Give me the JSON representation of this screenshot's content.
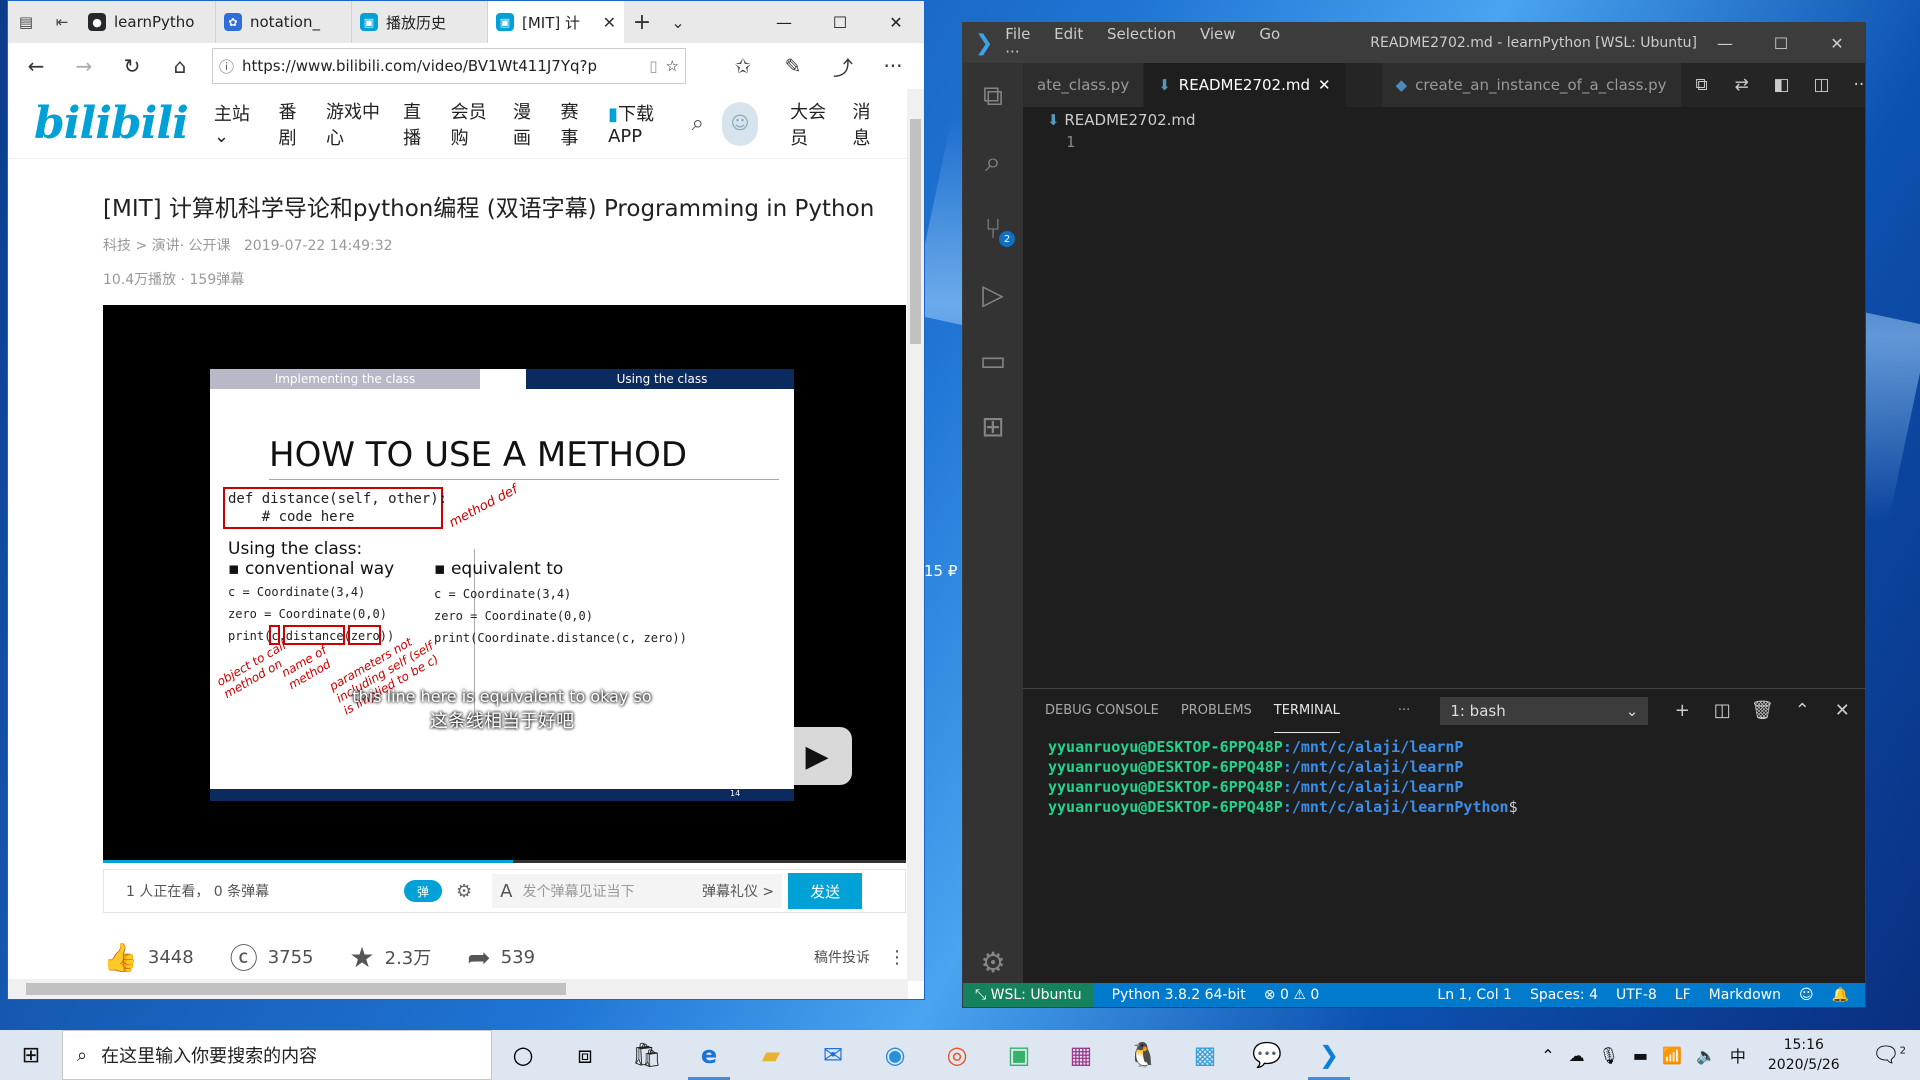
{
  "desktop": {
    "peek_text": "15 ₽"
  },
  "edge": {
    "tabs": [
      {
        "label": "learnPytho",
        "favicon": "github-icon",
        "color": "#24292e"
      },
      {
        "label": "notation_",
        "favicon": "baidu-icon",
        "color": "#2f6dd8"
      },
      {
        "label": "播放历史",
        "favicon": "bilibili-icon",
        "color": "#00a1d6"
      },
      {
        "label": "[MIT] 计",
        "favicon": "bilibili-icon",
        "color": "#00a1d6"
      }
    ],
    "url": "https://www.bilibili.com/video/BV1Wt411J7Yq?p",
    "nav": {
      "main": "主站",
      "items": [
        "番剧",
        "游戏中心",
        "直播",
        "会员购",
        "漫画",
        "赛事"
      ],
      "download": "下载APP",
      "vip": "大会员",
      "msg": "消息"
    },
    "video": {
      "title": "[MIT] 计算机科学导论和python编程 (双语字幕) Programming in Python",
      "category": "科技 > 演讲· 公开课",
      "date": "2019-07-22 14:49:32",
      "stats": "10.4万播放 · 159弹幕",
      "slide": {
        "tab_left": "Implementing the class",
        "tab_right": "Using the class",
        "heading": "HOW TO USE A METHOD",
        "code1": "def distance(self, other):",
        "code2": "    # code here",
        "method_def": "method def",
        "using": "Using the class:",
        "conventional": "conventional way",
        "equivalent": "equivalent to",
        "l1": "c = Coordinate(3,4)",
        "l2": "zero = Coordinate(0,0)",
        "l3": "print(c.distance(zero))",
        "r1": "c = Coordinate(3,4)",
        "r2": "zero = Coordinate(0,0)",
        "r3": "print(Coordinate.distance(c, zero))",
        "ann1": "object to call method on",
        "ann2": "name of method",
        "ann3": "parameters not including self (self is implied to be c)",
        "page": "14"
      },
      "subtitle_en": "this line here is equivalent to okay so",
      "subtitle_zh": "这条线相当于好吧",
      "progress": 0.51
    },
    "danmaku": {
      "watching": "1 人正在看， 0 条弹幕",
      "toggle": "弹",
      "placeholder": "发个弹幕见证当下",
      "etiquette": "弹幕礼仪 >",
      "send": "发送"
    },
    "actions": {
      "like": "3448",
      "coin": "3755",
      "fav": "2.3万",
      "share": "539",
      "report": "稿件投诉"
    }
  },
  "vscode": {
    "menu": [
      "File",
      "Edit",
      "Selection",
      "View",
      "Go",
      "···"
    ],
    "title": "README2702.md - learnPython [WSL: Ubuntu] ...",
    "tabs": [
      {
        "label": "ate_class.py",
        "icon": "python-icon"
      },
      {
        "label": "README2702.md",
        "icon": "markdown-icon"
      },
      {
        "label": "create_an_instance_of_a_class.py",
        "icon": "python-icon"
      }
    ],
    "breadcrumb": "README2702.md",
    "line": "1",
    "scm_badge": "2",
    "panel_tabs": [
      "DEBUG CONSOLE",
      "PROBLEMS",
      "TERMINAL",
      "···"
    ],
    "terminal_select": "1: bash",
    "terminal_lines": [
      {
        "user": "yyuanruoyu@DESKTOP-6PPQ48P",
        "path": ":/mnt/c/alaji/learnP"
      },
      {
        "user": "yyuanruoyu@DESKTOP-6PPQ48P",
        "path": ":/mnt/c/alaji/learnP"
      },
      {
        "user": "yyuanruoyu@DESKTOP-6PPQ48P",
        "path": ":/mnt/c/alaji/learnP"
      },
      {
        "user": "yyuanruoyu@DESKTOP-6PPQ48P",
        "path": ":/mnt/c/alaji/learnPython",
        "suffix": "$"
      }
    ],
    "status": {
      "remote": "WSL: Ubuntu",
      "python": "Python 3.8.2 64-bit",
      "problems": "⊗ 0 ⚠ 0",
      "pos": "Ln 1, Col 1",
      "spaces": "Spaces: 4",
      "enc": "UTF-8",
      "eol": "LF",
      "lang": "Markdown"
    }
  },
  "taskbar": {
    "search_placeholder": "在这里输入你要搜索的内容",
    "ime": "中",
    "time": "15:16",
    "date": "2020/5/26",
    "notif_count": "2"
  }
}
